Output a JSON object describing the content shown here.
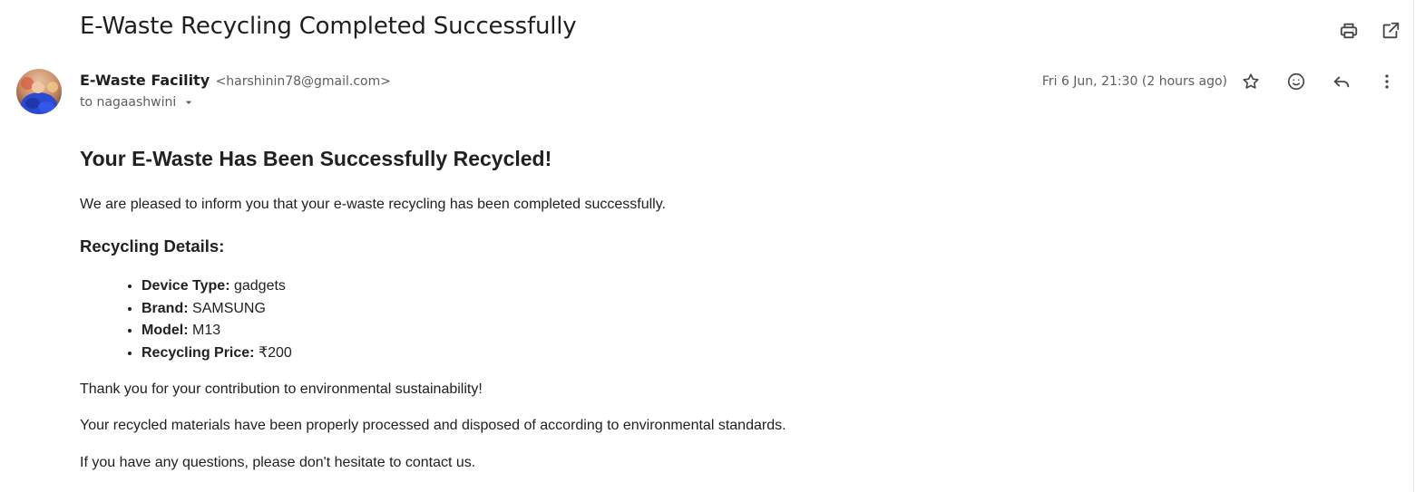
{
  "email": {
    "subject": "E-Waste Recycling Completed Successfully",
    "sender_name": "E-Waste Facility",
    "sender_email": "<harshinin78@gmail.com>",
    "to_line": "to nagaashwini",
    "timestamp": "Fri 6 Jun, 21:30 (2 hours ago)"
  },
  "icons": {
    "print": "printer-icon",
    "open_new_window": "open-in-new-icon",
    "star": "star-icon",
    "emoji": "emoji-react-icon",
    "reply": "reply-icon",
    "more": "more-vert-icon",
    "dropdown": "caret-down-icon"
  },
  "body": {
    "heading": "Your E-Waste Has Been Successfully Recycled!",
    "intro": "We are pleased to inform you that your e-waste recycling has been completed successfully.",
    "details_heading": "Recycling Details:",
    "details": [
      {
        "label": "Device Type:",
        "value": "gadgets"
      },
      {
        "label": "Brand:",
        "value": "SAMSUNG"
      },
      {
        "label": "Model:",
        "value": "M13"
      },
      {
        "label": "Recycling Price:",
        "value": "₹200"
      }
    ],
    "thank_you": "Thank you for your contribution to environmental sustainability!",
    "processed": "Your recycled materials have been properly processed and disposed of according to environmental standards.",
    "contact": "If you have any questions, please don't hesitate to contact us."
  },
  "colors": {
    "text_primary": "#1f1f1f",
    "text_secondary": "#5e5e5e",
    "icon": "#444746",
    "avatar_blue": "#2a4bd1"
  }
}
